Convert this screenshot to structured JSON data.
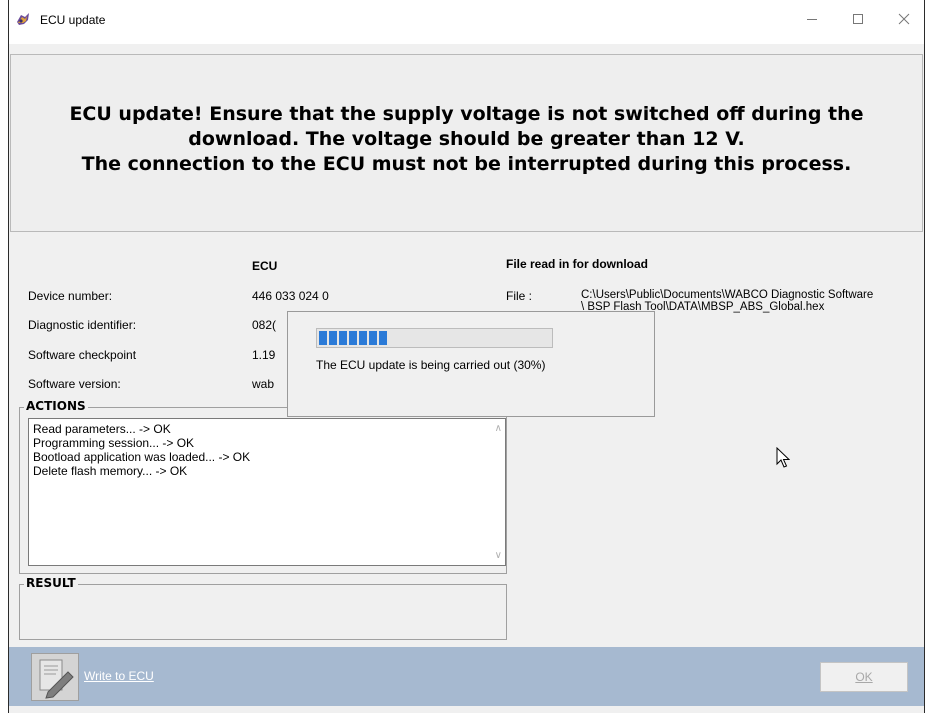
{
  "window": {
    "title": "ECU update"
  },
  "banner": {
    "lines": [
      "ECU update! Ensure that the supply voltage is not switched off during the",
      "download. The voltage should be greater than 12 V.",
      "The connection to the ECU must not be interrupted during this process."
    ]
  },
  "ecu_info": {
    "column_header": "ECU",
    "rows": [
      {
        "label": "Device number:",
        "value": "446 033 024 0"
      },
      {
        "label": "Diagnostic identifier:",
        "value": "082("
      },
      {
        "label": "Software checkpoint",
        "value": "1.19"
      },
      {
        "label": "Software version:",
        "value": "wab"
      }
    ]
  },
  "file_info": {
    "header": "File read in for download",
    "label": "File :",
    "path_line1": "C:\\Users\\Public\\Documents\\WABCO Diagnostic Software",
    "path_line2": "\\ BSP Flash Tool\\DATA\\MBSP_ABS_Global.hex"
  },
  "actions": {
    "title": "ACTIONS",
    "log": [
      "Read parameters... -> OK",
      "Programming session... -> OK",
      "Bootload application was loaded... -> OK",
      "Delete flash memory... -> OK"
    ]
  },
  "result": {
    "title": "RESULT"
  },
  "progress": {
    "percent": 30,
    "text": "The ECU update is being carried out (30%)"
  },
  "footer": {
    "write_label": "Write to ECU",
    "ok_label": "OK"
  },
  "colors": {
    "footer_bg": "#a6b9d0",
    "progress_fill": "#2a7ad7"
  },
  "icons": [
    "app-icon",
    "minimize-icon",
    "maximize-icon",
    "close-icon",
    "write-to-ecu-icon",
    "cursor-icon"
  ]
}
